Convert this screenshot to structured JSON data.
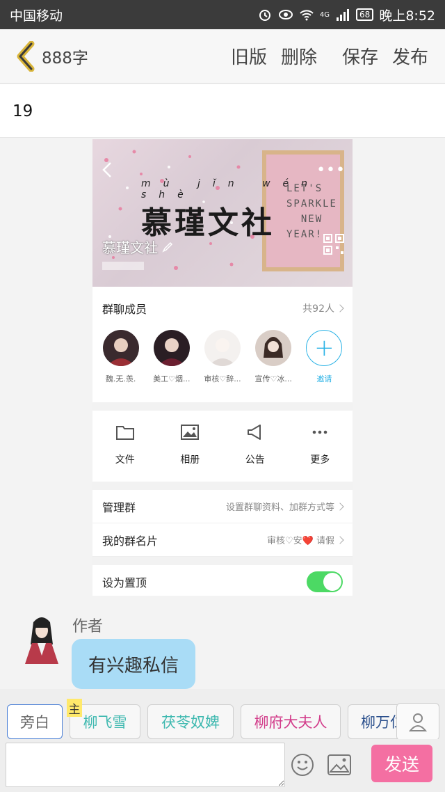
{
  "status_bar": {
    "carrier": "中国移动",
    "network": "4G",
    "battery": "68",
    "time": "晚上8:52"
  },
  "header": {
    "word_count": "888字",
    "actions": [
      "旧版",
      "删除",
      "保存",
      "发布"
    ]
  },
  "title": "19",
  "screenshot": {
    "group_name": "慕瑾文社",
    "banner_calligraphy": "慕瑾文社",
    "banner_pinyin": "mù jǐn wén shè",
    "board_text": "LET'S\nSPARKLE\n  NEW\nYEAR!",
    "members_label": "群聊成员",
    "members_count": "共92人",
    "members": [
      {
        "name": "魏.无.羡.",
        "color": "#8a3b3b"
      },
      {
        "name": "美工♡烟...",
        "color": "#5a2c3a"
      },
      {
        "name": "审核♡辞...",
        "color": "#e9e4e2"
      },
      {
        "name": "宣传♡冰...",
        "color": "#6b5a55"
      }
    ],
    "invite_label": "邀请",
    "tools": [
      {
        "label": "文件",
        "icon": "folder-icon"
      },
      {
        "label": "相册",
        "icon": "album-icon"
      },
      {
        "label": "公告",
        "icon": "megaphone-icon"
      },
      {
        "label": "更多",
        "icon": "more-icon"
      }
    ],
    "manage_label": "管理群",
    "manage_value": "设置群聊资料、加群方式等",
    "card_label": "我的群名片",
    "card_value": "审核♡安❤️ 请假",
    "pin_label": "设为置顶",
    "accent_color": "#4cd964"
  },
  "chat": {
    "author_label": "作者",
    "message": "有兴趣私信"
  },
  "roles": {
    "items": [
      {
        "label": "旁白",
        "color": "#666666"
      },
      {
        "label": "柳飞雪",
        "color": "#3fb9b0"
      },
      {
        "label": "茯苓奴婢",
        "color": "#3fb9b0"
      },
      {
        "label": "柳府大夫人",
        "color": "#d23c8a"
      },
      {
        "label": "柳万仁",
        "color": "#2a4f8c"
      }
    ],
    "main_badge": "主"
  },
  "composer": {
    "input_value": "",
    "send_label": "发送"
  }
}
